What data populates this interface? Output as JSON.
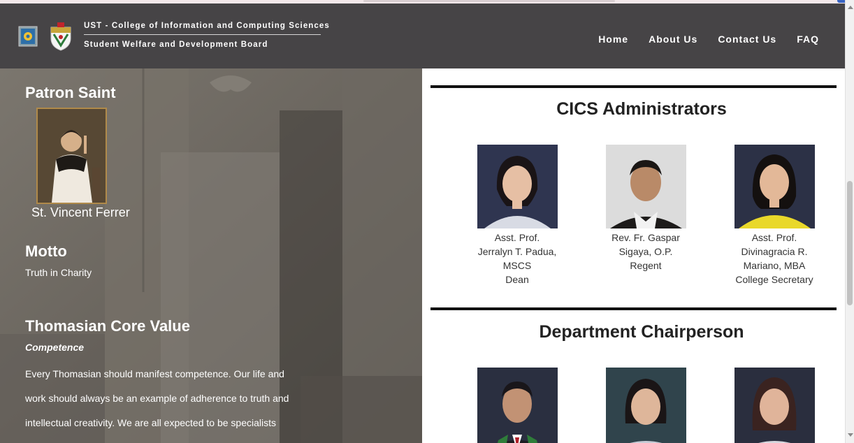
{
  "header": {
    "brand_line1": "UST - College of Information and Computing Sciences",
    "brand_line2": "Student Welfare and Development Board",
    "logo_left_icon": "cics-seal-icon",
    "logo_right_icon": "ust-crest-icon",
    "nav": [
      {
        "label": "Home"
      },
      {
        "label": "About Us"
      },
      {
        "label": "Contact Us"
      },
      {
        "label": "FAQ"
      }
    ]
  },
  "left": {
    "patron_heading": "Patron Saint",
    "saint_name": "St. Vincent Ferrer",
    "motto_heading": "Motto",
    "motto_text": "Truth in Charity",
    "core_heading": "Thomasian Core Value",
    "core_value": "Competence",
    "core_paragraph": "Every Thomasian should manifest competence. Our life and work should always be an example of adherence to truth and intellectual creativity. We are all expected to be specialists"
  },
  "right": {
    "admin_heading": "CICS Administrators",
    "administrators": [
      {
        "line1": "Asst. Prof.",
        "line2": "Jerralyn T. Padua,",
        "line3": "MSCS",
        "line4": "Dean"
      },
      {
        "line1": "Rev. Fr. Gaspar",
        "line2": "Sigaya, O.P.",
        "line3": "Regent",
        "line4": ""
      },
      {
        "line1": "Asst. Prof.",
        "line2": "Divinagracia R.",
        "line3": "Mariano, MBA",
        "line4": "College Secretary"
      }
    ],
    "chair_heading": "Department Chairperson"
  },
  "colors": {
    "header_bg": "#464446",
    "divider": "#111111",
    "text_dark": "#222222"
  }
}
